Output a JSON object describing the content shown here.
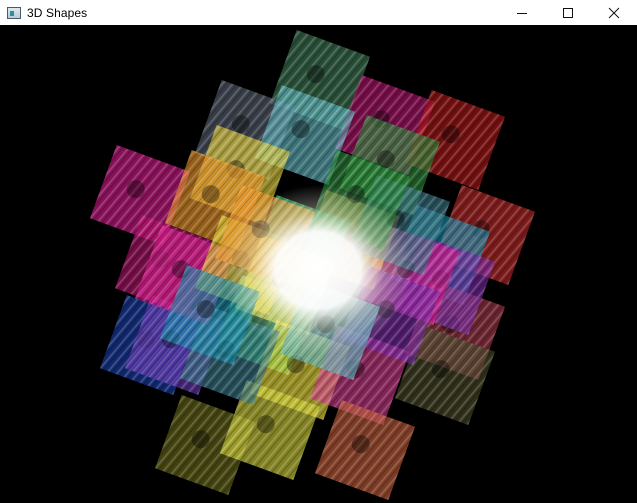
{
  "window": {
    "title": "3D Shapes"
  },
  "titlebar": {
    "app_icon": "window-app-icon",
    "controls": [
      {
        "name": "minimize",
        "icon": "minimize-icon"
      },
      {
        "name": "maximize",
        "icon": "maximize-icon"
      },
      {
        "name": "close",
        "icon": "close-icon"
      }
    ]
  },
  "scene": {
    "description_icon": "rotating-textured-cubes",
    "background_color": "#000000",
    "tile_colors": [
      "#3f7a55",
      "#b8146e",
      "#b41818",
      "#596272",
      "#5fb7c0",
      "#d81a8c",
      "#2c8a3a",
      "#c42a2a",
      "#e7d23a",
      "#f19a2a",
      "#1a3fae",
      "#6a3ab8",
      "#1a8fb0",
      "#2ec46a",
      "#f0e23a",
      "#d03a8a",
      "#a83a4a",
      "#4a4a2a",
      "#6b6b1a",
      "#d2d23a",
      "#c8603a",
      "#7a2aa8",
      "#3a7a8a",
      "#ffffff"
    ]
  }
}
